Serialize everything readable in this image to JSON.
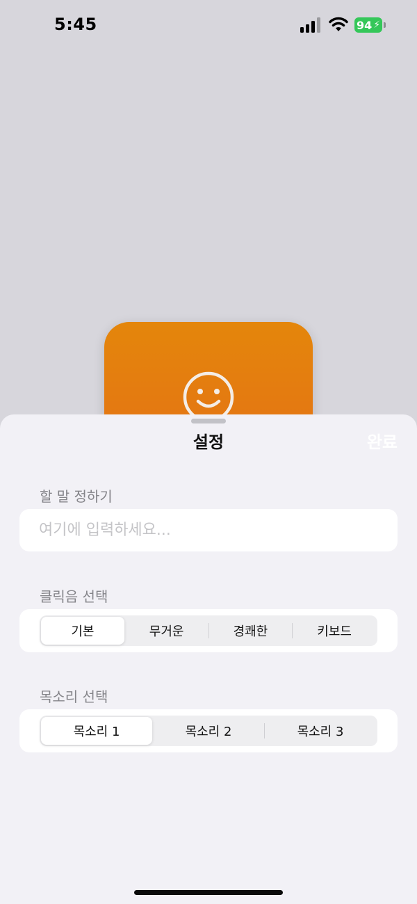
{
  "status_bar": {
    "time": "5:45",
    "battery": "94",
    "battery_color": "#34c759"
  },
  "background_card": {
    "icon": "smile-icon",
    "gradient": [
      "#e4860b",
      "#e4681a"
    ]
  },
  "sheet": {
    "title": "설정",
    "done_label": "완료",
    "message_section": {
      "label": "할 말 정하기",
      "placeholder": "여기에 입력하세요...",
      "value": ""
    },
    "click_sound_section": {
      "label": "클릭음 선택",
      "options": [
        "기본",
        "무거운",
        "경쾌한",
        "키보드"
      ],
      "selected": "기본"
    },
    "voice_section": {
      "label": "목소리 선택",
      "options": [
        "목소리 1",
        "목소리 2",
        "목소리 3"
      ],
      "selected": "목소리 1"
    }
  }
}
